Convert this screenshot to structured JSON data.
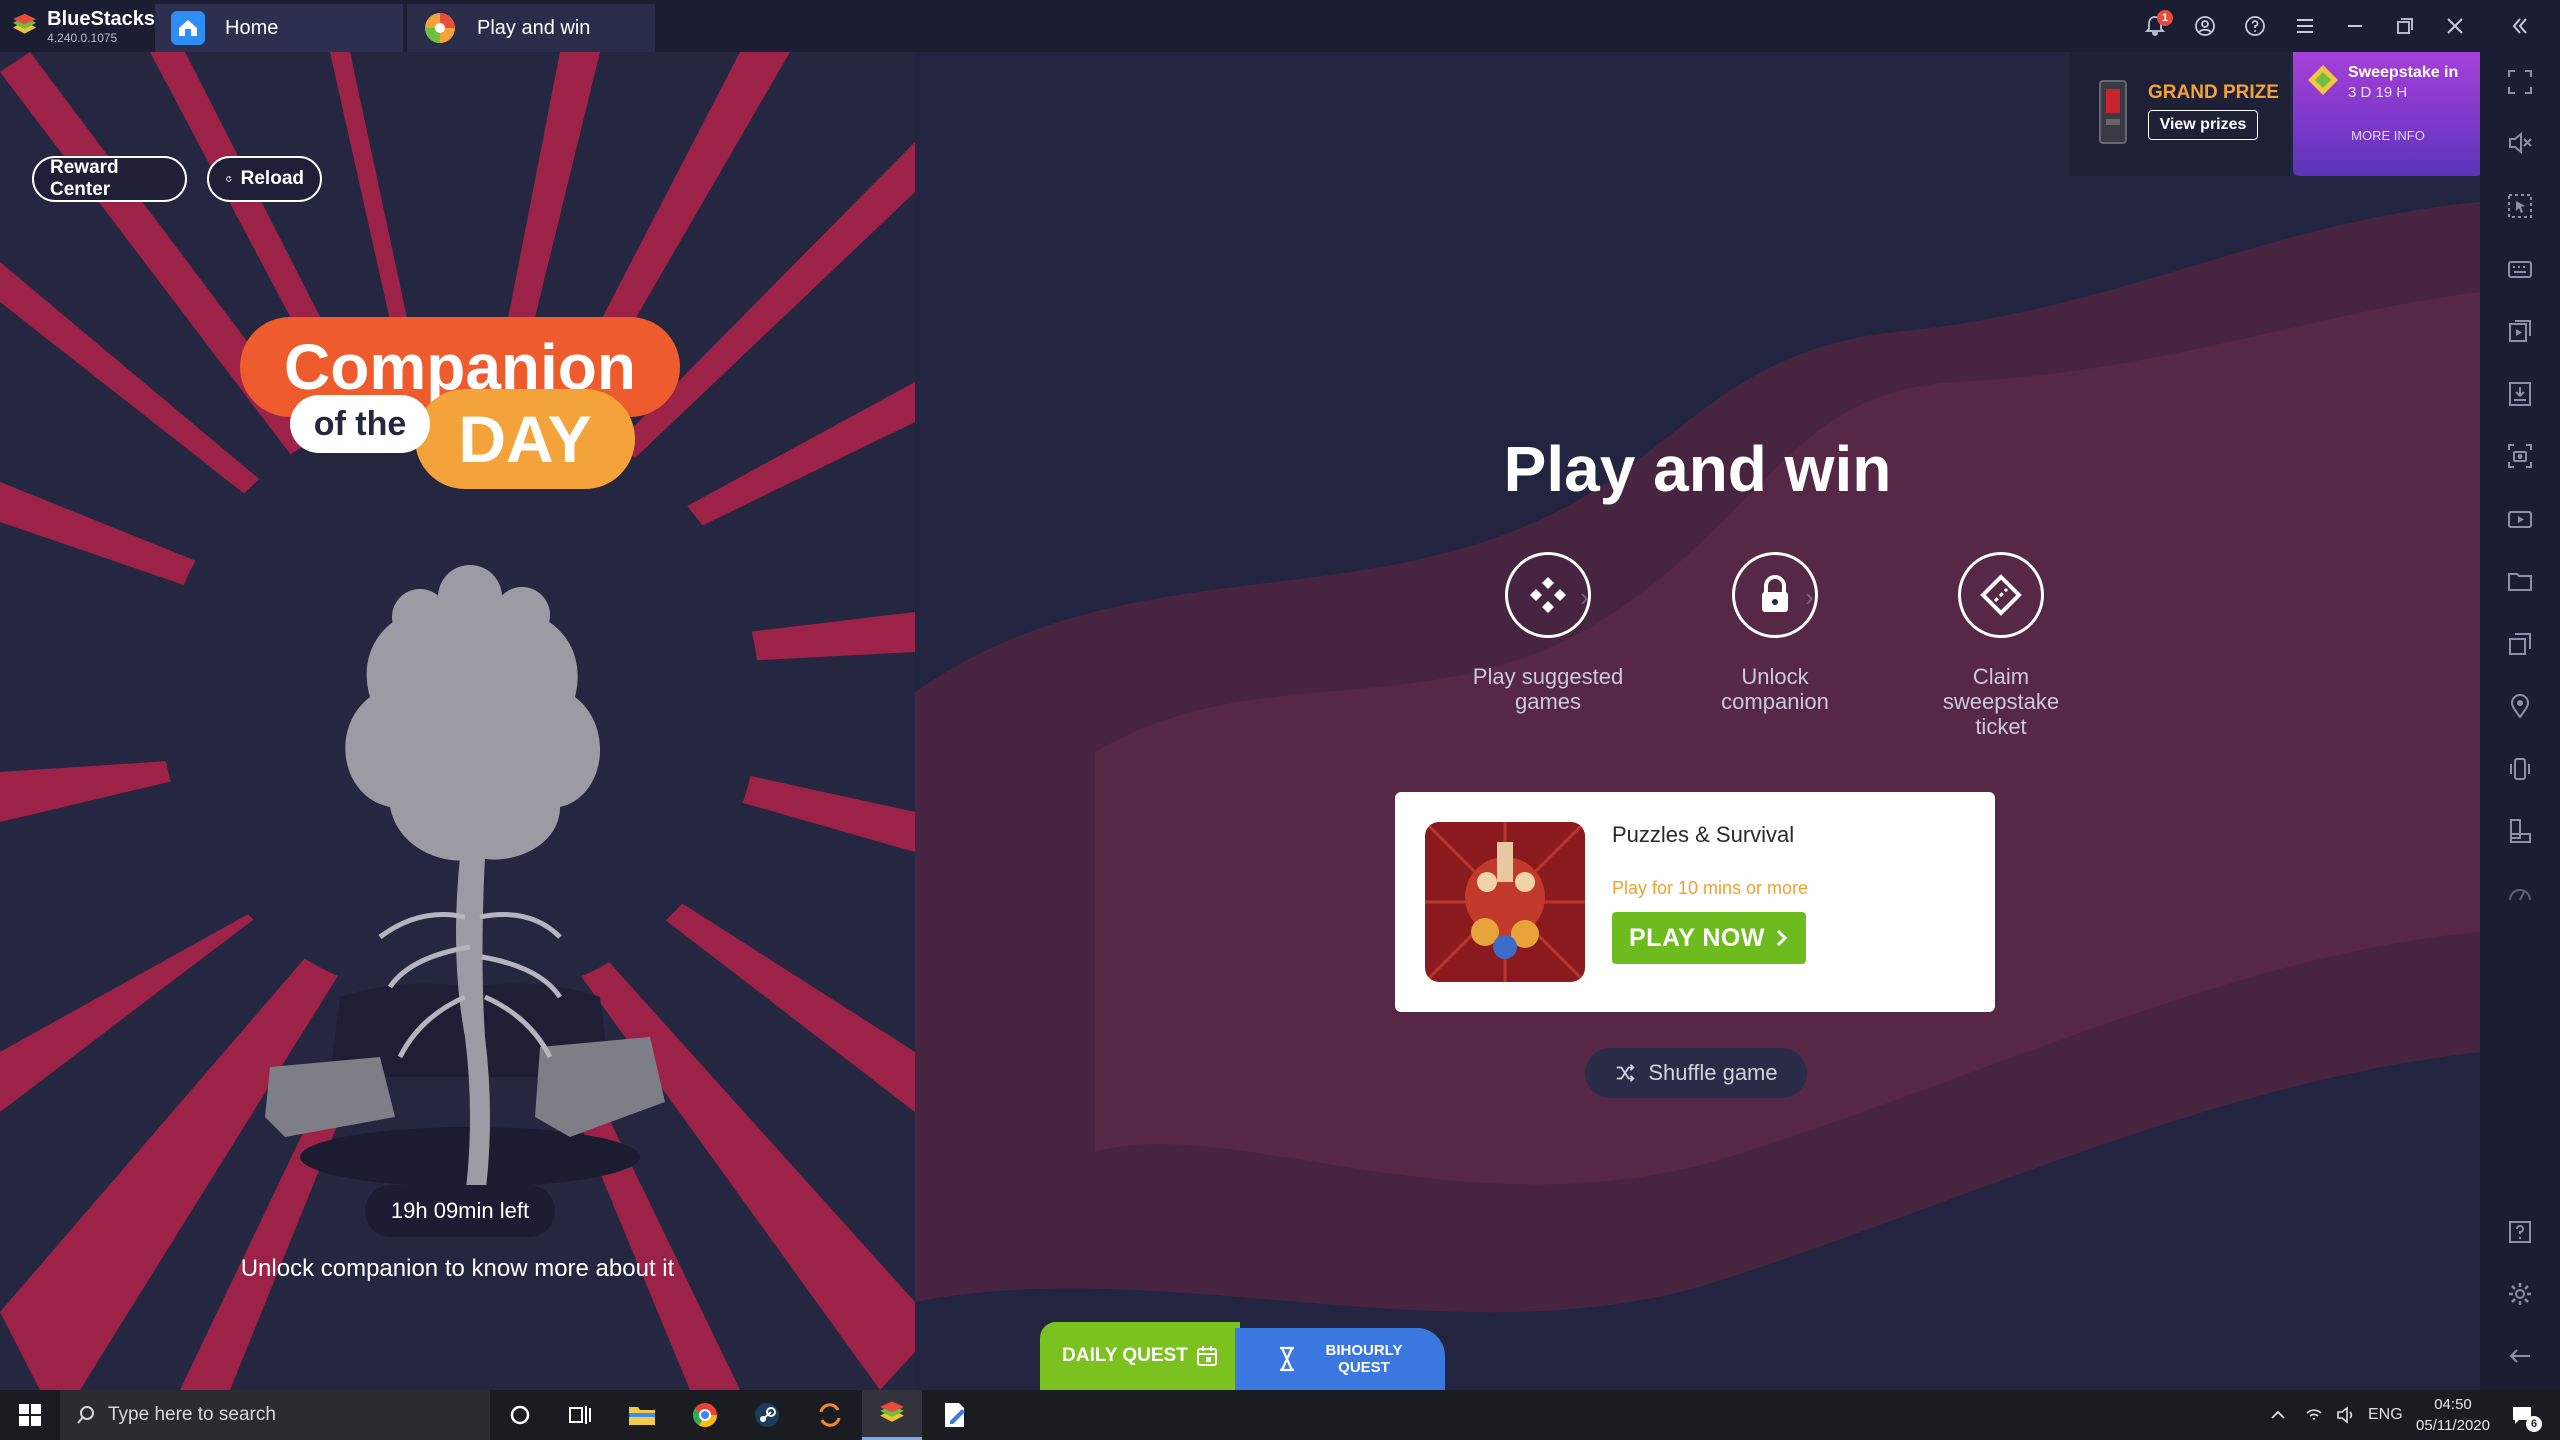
{
  "window": {
    "brand_name": "BlueStacks",
    "brand_version": "4.240.0.1075",
    "tabs": [
      {
        "label": "Home"
      },
      {
        "label": "Play and win"
      }
    ],
    "notification_count": "1"
  },
  "left": {
    "reward_center_label": "Reward Center",
    "reload_label": "Reload",
    "logo": {
      "line1": "Companion",
      "line2": "of the",
      "line3": "DAY"
    },
    "timer": "19h 09min left",
    "unlock_text": "Unlock companion to know more about it"
  },
  "main": {
    "title": "Play and win",
    "steps": [
      {
        "label": "Play suggested games",
        "icon": "gamepad-icon"
      },
      {
        "label": "Unlock companion",
        "icon": "lock-icon"
      },
      {
        "label": "Claim sweepstake ticket",
        "icon": "ticket-icon"
      }
    ],
    "game": {
      "name": "Puzzles & Survival",
      "requirement": "Play for 10 mins or more",
      "play_label": "PLAY NOW"
    },
    "shuffle_label": "Shuffle game",
    "grand_prize": {
      "label": "GRAND PRIZE",
      "button": "View prizes"
    },
    "sweepstake": {
      "title": "Sweepstake in",
      "time": "3 D 19 H",
      "more": "MORE INFO"
    },
    "quests": {
      "daily": "DAILY QUEST",
      "bihourly_line1": "BIHOURLY",
      "bihourly_line2": "QUEST"
    }
  },
  "taskbar": {
    "search_placeholder": "Type here to search",
    "language": "ENG",
    "time": "04:50",
    "date": "05/11/2020",
    "notif_count": "6"
  },
  "colors": {
    "accent_orange": "#ee5b2d",
    "accent_yellow": "#f4a33a",
    "play_green": "#6dbb1e",
    "quest_blue": "#3a78e0",
    "sweep_purple": "#a640d8"
  }
}
